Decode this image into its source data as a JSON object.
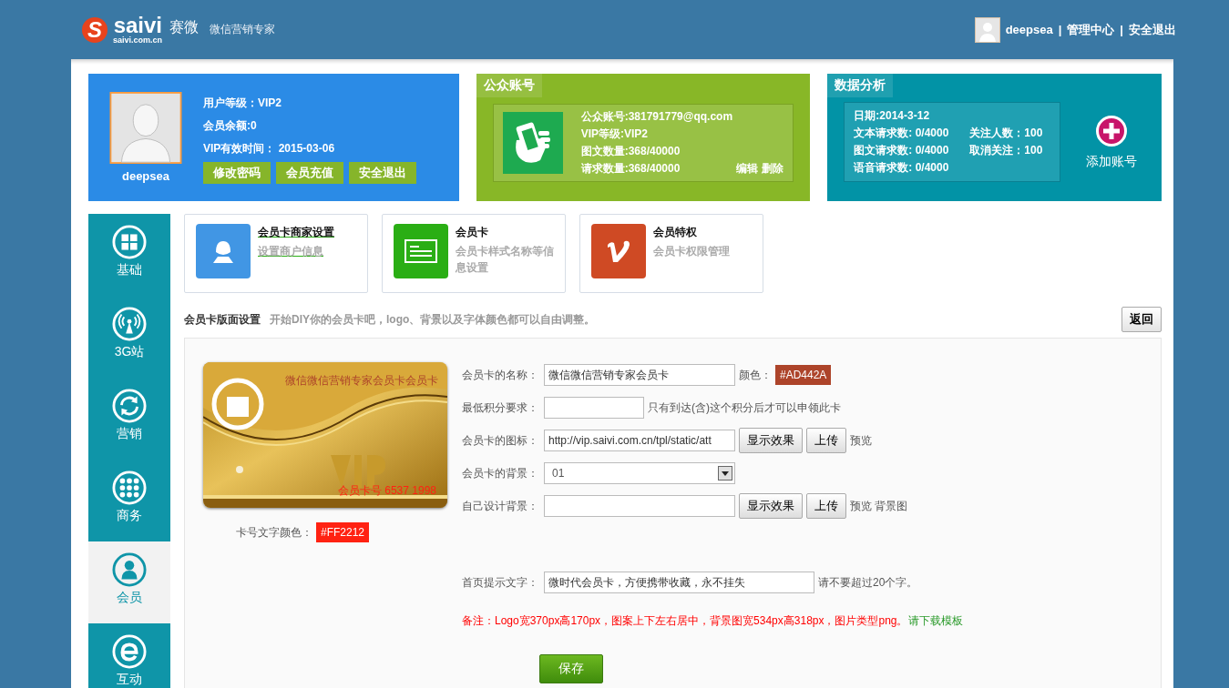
{
  "header": {
    "logo_mark": "S",
    "logo_text": "saivi",
    "logo_cn": "赛微",
    "logo_domain": "saivi.com.cn",
    "slogan": "微信营销专家",
    "user": "deepsea",
    "separator": "|",
    "links": [
      "管理中心",
      "安全退出"
    ]
  },
  "profile": {
    "name": "deepsea",
    "lines": [
      "用户等级：VIP2",
      "会员余额:0",
      "VIP有效时间： 2015-03-06"
    ],
    "buttons": [
      "修改密码",
      "会员充值",
      "安全退出"
    ]
  },
  "account": {
    "title": "公众账号",
    "lines": [
      "公众账号:381791779@qq.com",
      "VIP等级:VIP2",
      "图文数量:368/40000",
      "请求数量:368/40000"
    ],
    "actions": [
      "编辑",
      "删除"
    ]
  },
  "stats": {
    "title": "数据分析",
    "date": "日期:2014-3-12",
    "left": [
      "文本请求数: 0/4000",
      "图文请求数: 0/4000",
      "语音请求数: 0/4000"
    ],
    "right": [
      "关注人数：100",
      "取消关注：100"
    ],
    "add_label": "添加账号"
  },
  "sidebar": {
    "items": [
      {
        "label": "基础",
        "selected": false
      },
      {
        "label": "3G站",
        "selected": false
      },
      {
        "label": "营销",
        "selected": false
      },
      {
        "label": "商务",
        "selected": false
      },
      {
        "label": "会员",
        "selected": true
      },
      {
        "label": "互动",
        "selected": false
      }
    ]
  },
  "tiles": [
    {
      "title": "会员卡商家设置",
      "subtitle": "设置商户信息",
      "color": "#4196e4",
      "hovered": true
    },
    {
      "title": "会员卡",
      "subtitle": "会员卡样式名称等信息设置",
      "color": "#2aae14",
      "hovered": false
    },
    {
      "title": "会员特权",
      "subtitle": "会员卡权限管理",
      "color": "#cf4a24",
      "hovered": false
    }
  ],
  "section": {
    "title": "会员卡版面设置",
    "hint": "开始DIY你的会员卡吧，logo、背景以及字体颜色都可以自由调整。",
    "back_button": "返回"
  },
  "card_preview": {
    "name_text": "微信微信营销专家会员卡会员卡",
    "number_text": "会员卡号 6537 1998",
    "number_color_label": "卡号文字颜色：",
    "number_color": "#FF2212"
  },
  "form": {
    "rows": [
      {
        "kind": "text",
        "label": "会员卡的名称：",
        "value": "微信微信营销专家会员卡",
        "color_label": "颜色：",
        "color": "#AD442A"
      },
      {
        "kind": "short",
        "label": "最低积分要求：",
        "note": "只有到达(含)这个积分后才可以申领此卡"
      },
      {
        "kind": "text",
        "label": "会员卡的图标：",
        "value": "http://vip.saivi.com.cn/tpl/static/att",
        "buttons": [
          "显示效果",
          "上传"
        ],
        "note": "预览"
      },
      {
        "kind": "select",
        "label": "会员卡的背景：",
        "value": "01"
      },
      {
        "kind": "text",
        "label": "自己设计背景：",
        "buttons": [
          "显示效果",
          "上传"
        ],
        "note": "预览 背景图"
      },
      {
        "kind": "gap"
      },
      {
        "kind": "long",
        "label": "首页提示文字：",
        "value": "微时代会员卡，方便携带收藏，永不挂失",
        "note": "请不要超过20个字。"
      }
    ],
    "remark": "备注：Logo宽370px高170px，图案上下左右居中，背景图宽534px高318px，图片类型png。",
    "download_link": "请下载模板",
    "save_button": "保存"
  }
}
